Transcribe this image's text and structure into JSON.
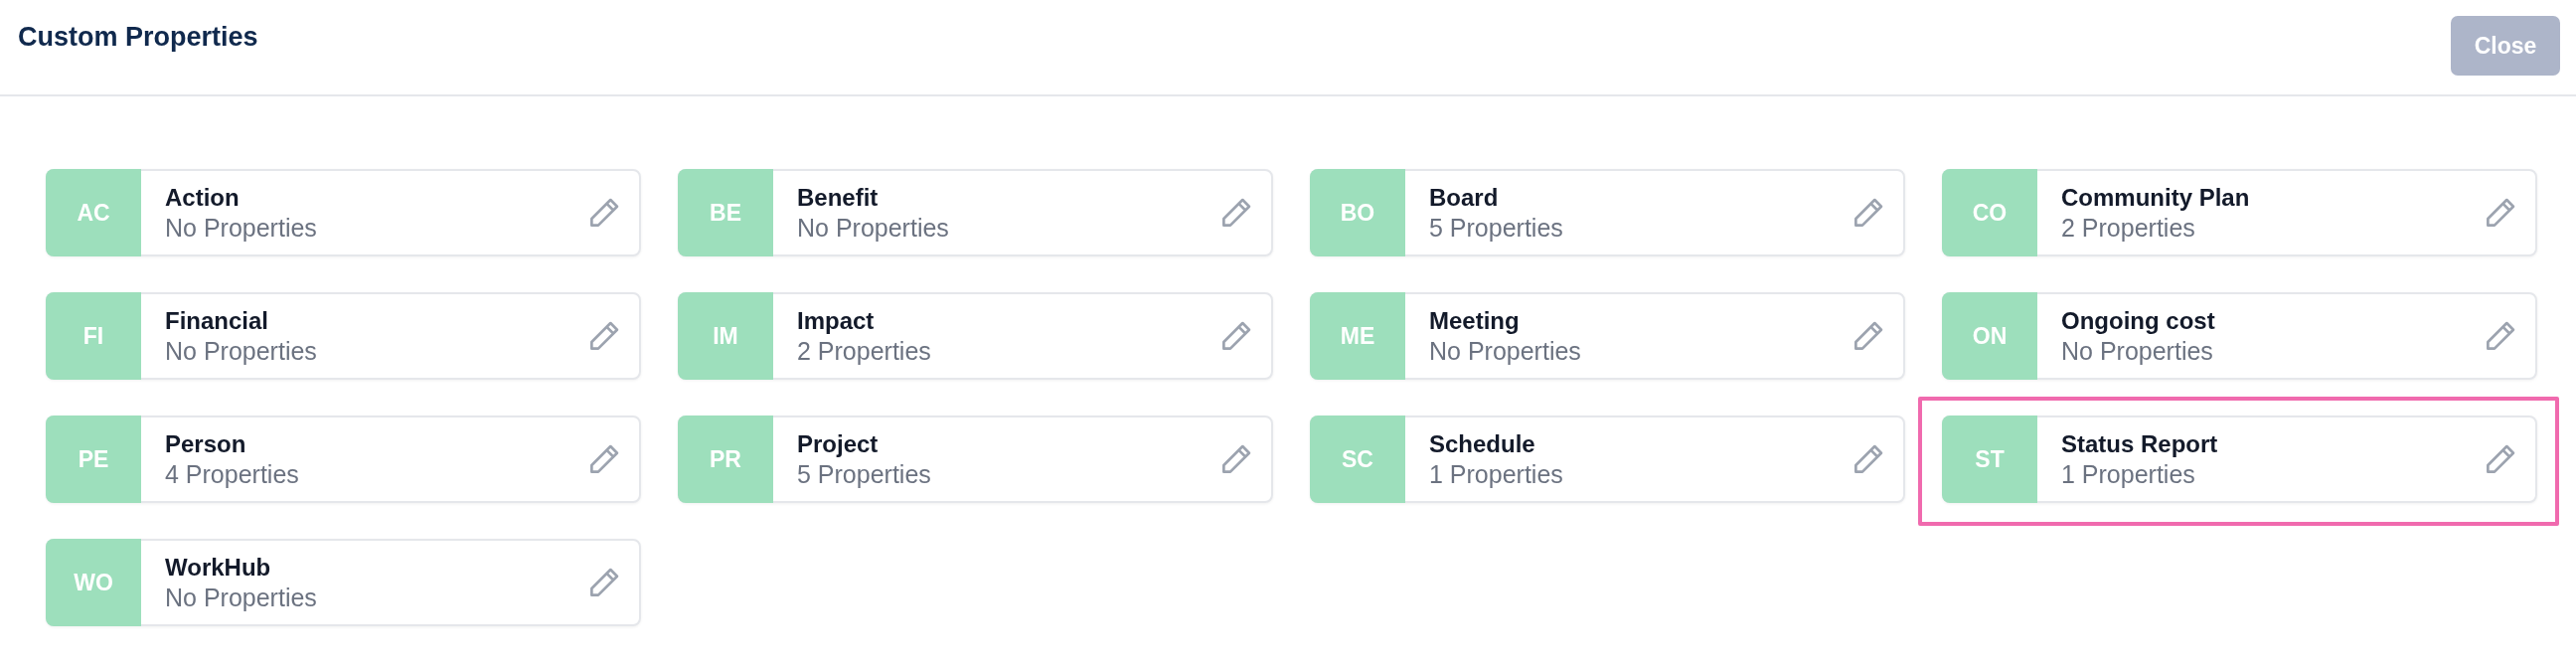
{
  "header": {
    "title": "Custom Properties",
    "close_button": "Close"
  },
  "groups": [
    {
      "initials": "AC",
      "name": "Action",
      "count": "No Properties",
      "selected": false
    },
    {
      "initials": "BE",
      "name": "Benefit",
      "count": "No Properties",
      "selected": false
    },
    {
      "initials": "BO",
      "name": "Board",
      "count": "5 Properties",
      "selected": false
    },
    {
      "initials": "CO",
      "name": "Community Plan",
      "count": "2 Properties",
      "selected": false
    },
    {
      "initials": "FI",
      "name": "Financial",
      "count": "No Properties",
      "selected": false
    },
    {
      "initials": "IM",
      "name": "Impact",
      "count": "2 Properties",
      "selected": false
    },
    {
      "initials": "ME",
      "name": "Meeting",
      "count": "No Properties",
      "selected": false
    },
    {
      "initials": "ON",
      "name": "Ongoing cost",
      "count": "No Properties",
      "selected": false
    },
    {
      "initials": "PE",
      "name": "Person",
      "count": "4 Properties",
      "selected": false
    },
    {
      "initials": "PR",
      "name": "Project",
      "count": "5 Properties",
      "selected": false
    },
    {
      "initials": "SC",
      "name": "Schedule",
      "count": "1 Properties",
      "selected": false
    },
    {
      "initials": "ST",
      "name": "Status Report",
      "count": "1 Properties",
      "selected": true
    },
    {
      "initials": "WO",
      "name": "WorkHub",
      "count": "No Properties",
      "selected": false
    }
  ]
}
